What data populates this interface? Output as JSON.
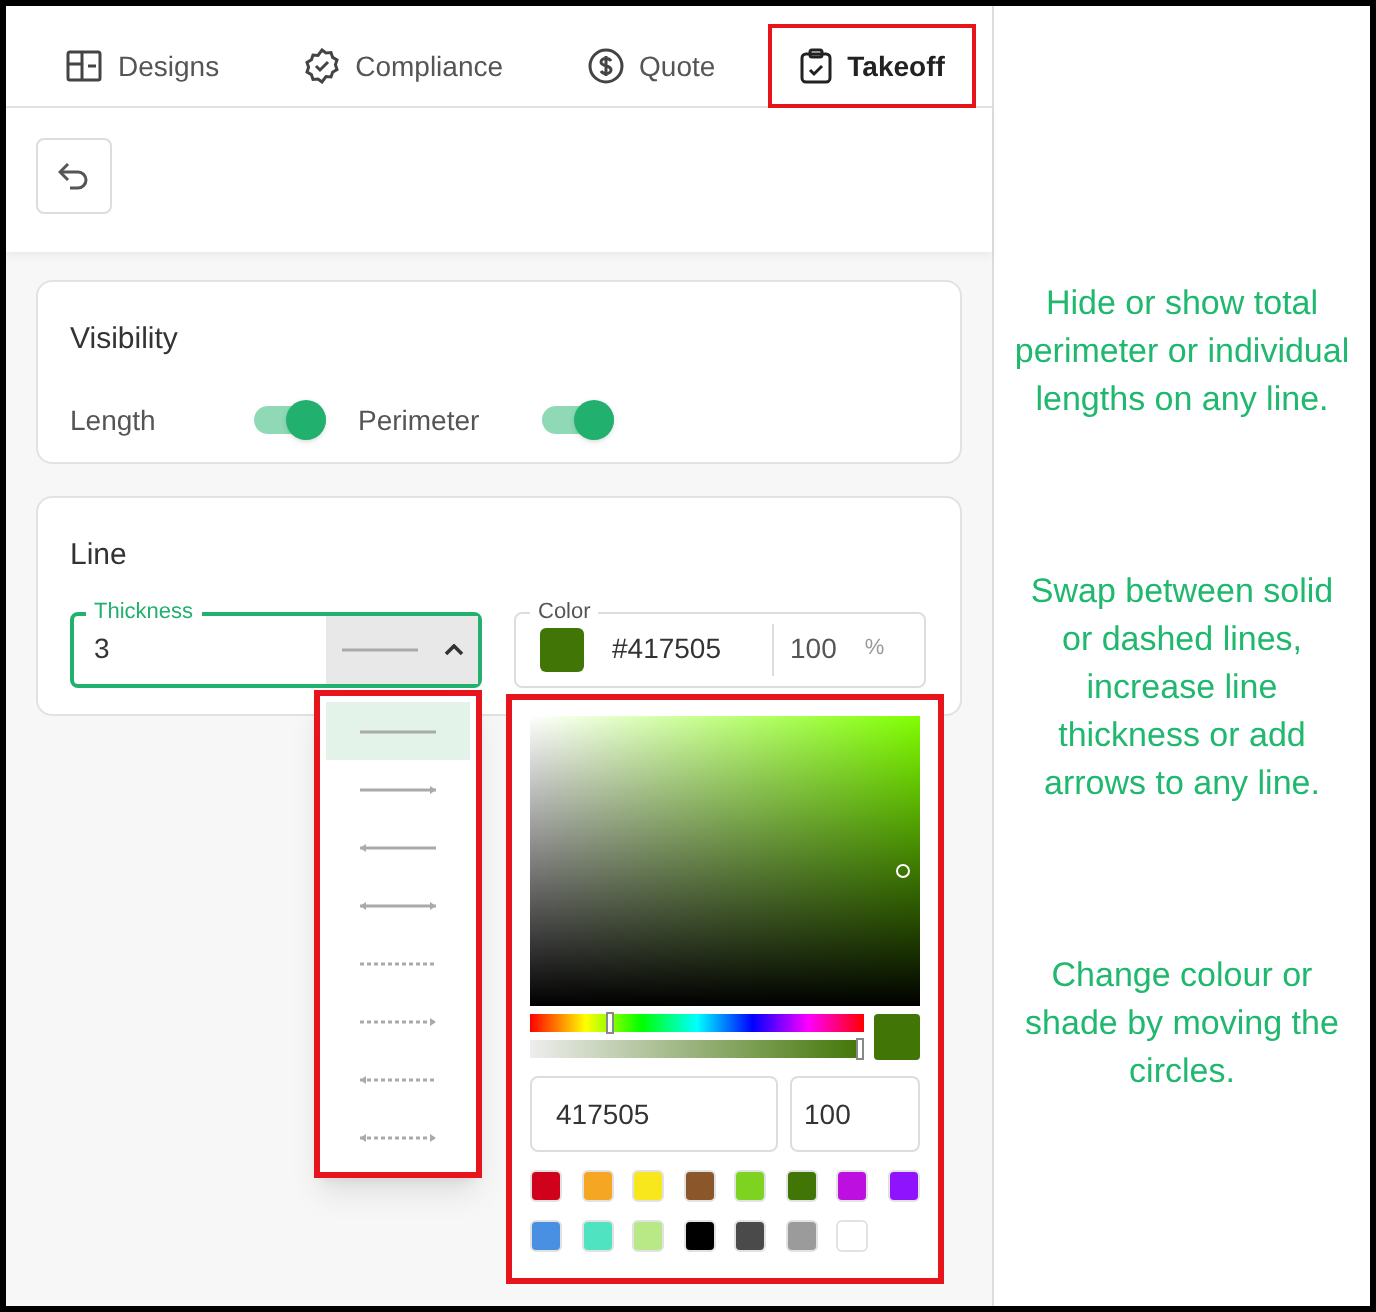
{
  "tabs": [
    {
      "label": "Designs",
      "kind": "designs",
      "selected": false,
      "highlighted": false
    },
    {
      "label": "Compliance",
      "kind": "compliance",
      "selected": false,
      "highlighted": false
    },
    {
      "label": "Quote",
      "kind": "quote",
      "selected": false,
      "highlighted": false
    },
    {
      "label": "Takeoff",
      "kind": "takeoff",
      "selected": true,
      "highlighted": true
    }
  ],
  "visibility": {
    "title": "Visibility",
    "toggles": [
      {
        "label": "Length",
        "on": true
      },
      {
        "label": "Perimeter",
        "on": true
      }
    ]
  },
  "line": {
    "title": "Line",
    "thickness": {
      "label": "Thickness",
      "value": "3"
    },
    "color": {
      "label": "Color",
      "value": "#417505",
      "opacity": "100",
      "unit": "%"
    }
  },
  "line_style_menu": {
    "highlighted": true,
    "options": [
      {
        "kind": "solid",
        "selected": true
      },
      {
        "kind": "arrow-end",
        "selected": false
      },
      {
        "kind": "arrow-start",
        "selected": false
      },
      {
        "kind": "arrow-both",
        "selected": false
      },
      {
        "kind": "dashed",
        "selected": false
      },
      {
        "kind": "dashed-arrow-end",
        "selected": false
      },
      {
        "kind": "dashed-arrow-start",
        "selected": false
      },
      {
        "kind": "dashed-arrow-both",
        "selected": false
      }
    ]
  },
  "color_picker": {
    "highlighted": true,
    "hex": "417505",
    "alpha": "100",
    "swatches": [
      {
        "color": "#d0021b"
      },
      {
        "color": "#f5a623"
      },
      {
        "color": "#f8e71c"
      },
      {
        "color": "#8b572a"
      },
      {
        "color": "#7ed321"
      },
      {
        "color": "#417505"
      },
      {
        "color": "#bd10e0"
      },
      {
        "color": "#9013fe"
      },
      {
        "color": "#4a90e2"
      },
      {
        "color": "#50e3c2"
      },
      {
        "color": "#b8e986"
      },
      {
        "color": "#000000"
      },
      {
        "color": "#4a4a4a"
      },
      {
        "color": "#9b9b9b"
      },
      {
        "color": "#ffffff"
      }
    ]
  },
  "notes": [
    "Hide or show total perimeter or individual lengths on any line.",
    "Swap between solid or dashed lines, increase line thickness or add arrows to any line.",
    "Change colour or shade by moving the circles."
  ]
}
